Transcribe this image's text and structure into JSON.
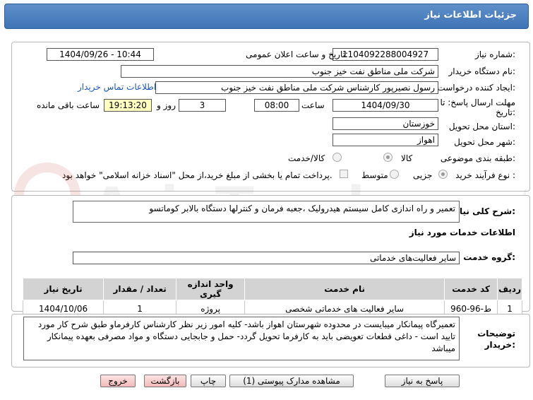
{
  "header": {
    "title": "جزئیات اطلاعات نیاز"
  },
  "form": {
    "need_number_label": "شماره نیاز:",
    "need_number": "1104092288004927",
    "announce_label": "تاریخ و ساعت اعلان عمومی:",
    "announce_value": "1404/09/26 - 10:44",
    "buyer_label": "نام دستگاه خریدار:",
    "buyer_value": "شرکت ملی مناطق نفت خیز جنوب",
    "creator_label": "ایجاد کننده درخواست:",
    "creator_value": "رسول نصیرپور کارشناس شرکت ملی مناطق نفت خیز جنوب",
    "contact_link": "اطلاعات تماس خریدار",
    "deadline_label_1": "مهلت ارسال پاسخ: تا",
    "deadline_label_2": "تاریخ:",
    "deadline_date": "1404/09/30",
    "time_label": "ساعت",
    "deadline_time": "08:00",
    "days_value": "3",
    "days_label": "روز و",
    "remaining_time": "19:13:20",
    "remaining_label": "ساعت باقی مانده",
    "province_label": "استان محل تحویل:",
    "province_value": "خوزستان",
    "city_label": "شهر محل تحویل:",
    "city_value": "اهواز",
    "category_label": "طبقه بندی موضوعی:",
    "category_options": [
      "کالا",
      "کالا/خدمت"
    ],
    "process_label": "نوع فرآیند خرید :",
    "process_options": [
      "جزیی",
      "متوسط"
    ],
    "payment_note": "پرداخت تمام یا بخشی از مبلغ خرید،از محل \"اسناد خزانه اسلامی\" خواهد بود."
  },
  "summary": {
    "label": "شرح کلی نیاز:",
    "value": "تعمیر و راه اندازی کامل سیستم هیدرولیک ،جعبه فرمان و کنترلها دستگاه بالابر کوماتسو"
  },
  "services": {
    "section_title": "اطلاعات خدمات مورد نیاز",
    "group_label": "گروه خدمت:",
    "group_value": "سایر فعالیت‌های خدماتی",
    "columns": [
      "ردیف",
      "کد خدمت",
      "نام خدمت",
      "واحد اندازه گیری",
      "تعداد / مقدار",
      "تاریخ نیاز"
    ],
    "rows": [
      [
        "1",
        "ط-96-960",
        "سایر فعالیت های خدماتی شخصی",
        "پروژه",
        "1",
        "1404/10/06"
      ]
    ]
  },
  "buyer_notes": {
    "label_1": "توضیحات",
    "label_2": "خریدار:",
    "text": "تعمیرگاه پیمانکار میبایست در محدوده شهرستان اهواز باشد- کلیه امور زیر نظر کارشناس کارفرماو طبق شرح کار مورد تایید است - داغی قطعات تعویضی باید به کارفرما تحویل گردد- حمل و جابجایی دستگاه و مواد مصرفی بعهده پیمانکار میباشد"
  },
  "buttons": {
    "reply": "پاسخ به نیاز",
    "attachments": "مشاهده مدارک پیوستی (1)",
    "print": "چاپ",
    "back": "بازگشت",
    "exit": "خروج"
  },
  "watermark": "AriaTender.net"
}
